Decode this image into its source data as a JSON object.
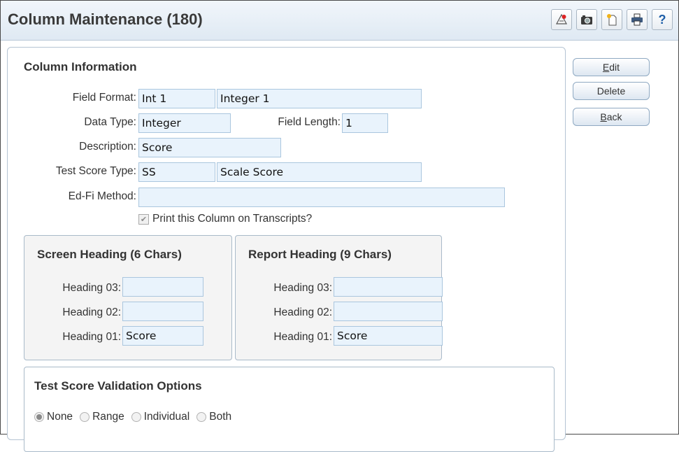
{
  "window": {
    "title": "Column Maintenance (180)"
  },
  "toolbar": {
    "icons": [
      "report-icon",
      "camera-icon",
      "new-document-icon",
      "print-icon",
      "help-icon"
    ],
    "help_label": "?"
  },
  "actions": {
    "edit_label": "Edit",
    "edit_underline": "E",
    "edit_rest": "dit",
    "delete_label": "Delete",
    "back_label": "Back",
    "back_underline": "B",
    "back_rest": "ack"
  },
  "column_info": {
    "title": "Column Information",
    "field_format_label": "Field Format:",
    "field_format_code": "Int 1",
    "field_format_desc": "Integer 1",
    "data_type_label": "Data Type:",
    "data_type_value": "Integer",
    "field_length_label": "Field Length:",
    "field_length_value": "1",
    "description_label": "Description:",
    "description_value": "Score",
    "test_score_type_label": "Test Score Type:",
    "test_score_type_code": "SS",
    "test_score_type_desc": "Scale Score",
    "edfi_method_label": "Ed-Fi Method:",
    "edfi_method_value": "",
    "print_on_transcripts_label": "Print this Column on Transcripts?",
    "print_on_transcripts_checked": true
  },
  "screen_heading": {
    "title": "Screen Heading (6 Chars)",
    "heading_03_label": "Heading 03:",
    "heading_03_value": "",
    "heading_02_label": "Heading 02:",
    "heading_02_value": "",
    "heading_01_label": "Heading 01:",
    "heading_01_value": "Score"
  },
  "report_heading": {
    "title": "Report Heading (9 Chars)",
    "heading_03_label": "Heading 03:",
    "heading_03_value": "",
    "heading_02_label": "Heading 02:",
    "heading_02_value": "",
    "heading_01_label": "Heading 01:",
    "heading_01_value": "Score"
  },
  "validation": {
    "title": "Test Score Validation Options",
    "options": [
      "None",
      "Range",
      "Individual",
      "Both"
    ],
    "selected": "None"
  },
  "colors": {
    "field_bg": "#e9f3fc",
    "field_border": "#aac6de",
    "title_text": "#3a3a3a"
  }
}
